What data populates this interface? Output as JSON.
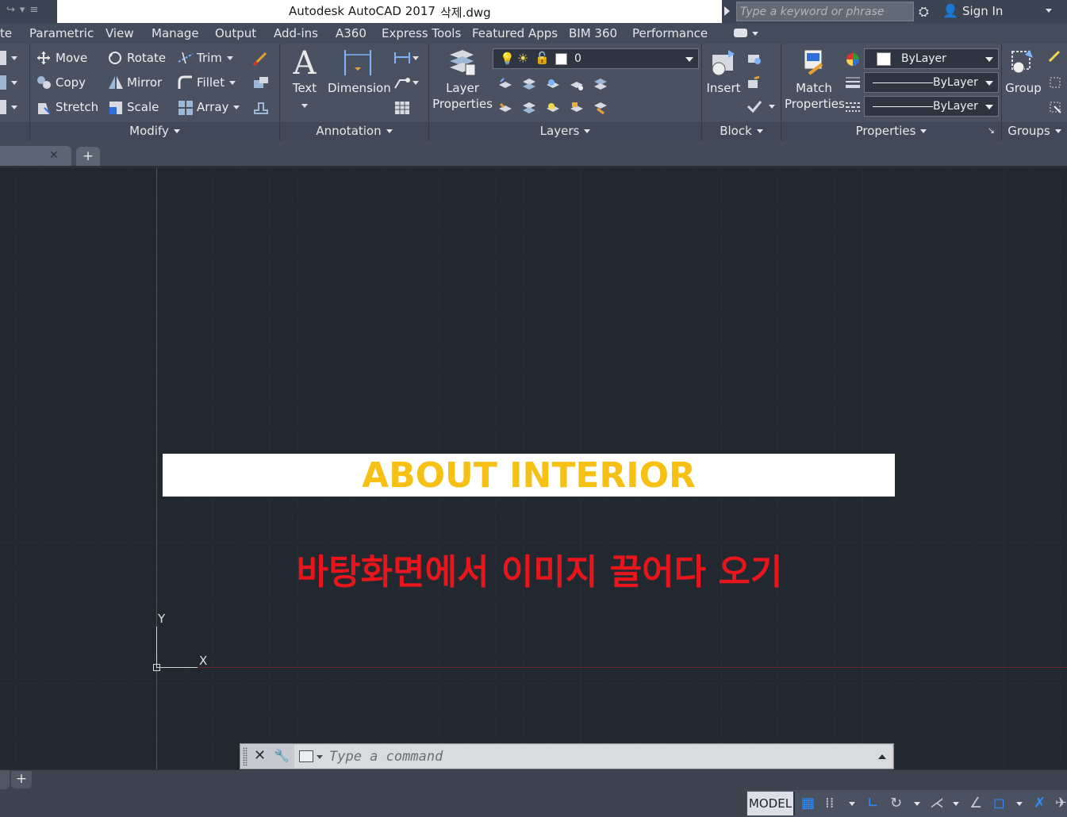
{
  "titlebar": {
    "app_title": "Autodesk AutoCAD 2017",
    "file_name": "삭제.dwg",
    "search_placeholder": "Type a keyword or phrase",
    "signin_label": "Sign In"
  },
  "ribbon_tabs": [
    {
      "label": "te"
    },
    {
      "label": "Parametric"
    },
    {
      "label": "View"
    },
    {
      "label": "Manage"
    },
    {
      "label": "Output"
    },
    {
      "label": "Add-ins"
    },
    {
      "label": "A360"
    },
    {
      "label": "Express Tools"
    },
    {
      "label": "Featured Apps"
    },
    {
      "label": "BIM 360"
    },
    {
      "label": "Performance"
    }
  ],
  "modify": {
    "move": "Move",
    "rotate": "Rotate",
    "trim": "Trim",
    "copy": "Copy",
    "mirror": "Mirror",
    "fillet": "Fillet",
    "stretch": "Stretch",
    "scale": "Scale",
    "array": "Array",
    "panel_label": "Modify"
  },
  "annotation": {
    "text": "Text",
    "dimension": "Dimension",
    "panel_label": "Annotation"
  },
  "layers": {
    "layer_properties_line1": "Layer",
    "layer_properties_line2": "Properties",
    "current_layer": "0",
    "panel_label": "Layers"
  },
  "block": {
    "insert": "Insert",
    "panel_label": "Block"
  },
  "properties": {
    "match_line1": "Match",
    "match_line2": "Properties",
    "color": "ByLayer",
    "linetype": "ByLayer",
    "lineweight": "ByLayer",
    "panel_label": "Properties"
  },
  "groups": {
    "group": "Group",
    "panel_label": "Groups"
  },
  "drawing": {
    "banner_text": "ABOUT INTERIOR",
    "korean_text": "바탕화면에서 이미지 끌어다 오기",
    "ucs_y": "Y",
    "ucs_x": "X"
  },
  "command_line": {
    "placeholder": "Type a command"
  },
  "statusbar": {
    "model": "MODEL"
  },
  "colors": {
    "banner_text": "#f6c014",
    "korean_text": "#e8151b",
    "canvas_bg": "#212830"
  }
}
